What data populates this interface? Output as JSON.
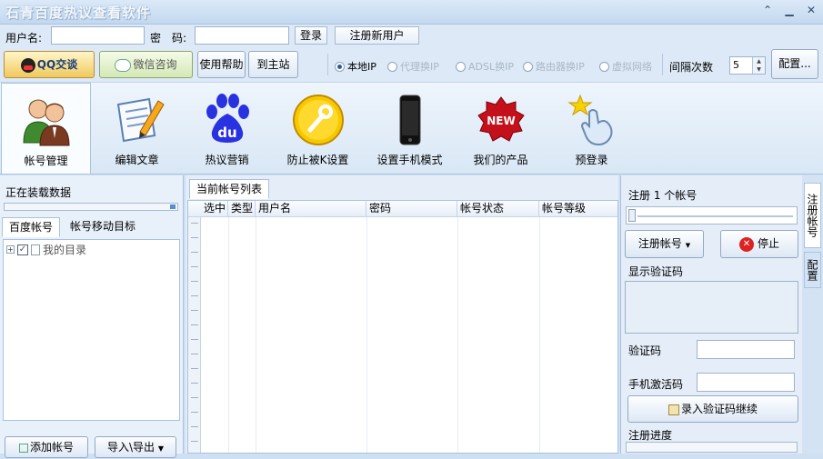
{
  "window": {
    "title": "石青百度热议查看软件"
  },
  "login": {
    "username_label": "用户名:",
    "username_value": "",
    "password_label": "密　码:",
    "password_value": "",
    "login_button": "登录",
    "register_button": "注册新用户"
  },
  "toolbar": {
    "qq_button": "QQ交谈",
    "wechat_button": "微信咨询",
    "help_button": "使用帮助",
    "site_button": "到主站",
    "ip_options": [
      {
        "label": "本地IP",
        "selected": true,
        "enabled": true
      },
      {
        "label": "代理换IP",
        "selected": false,
        "enabled": false
      },
      {
        "label": "ADSL换IP",
        "selected": false,
        "enabled": false
      },
      {
        "label": "路由器换IP",
        "selected": false,
        "enabled": false
      },
      {
        "label": "虚拟网络",
        "selected": false,
        "enabled": false
      }
    ],
    "interval_label": "间隔次数",
    "interval_value": "5",
    "config_button": "配置..."
  },
  "ribbon": {
    "tabs": [
      {
        "label": "帐号管理",
        "icon": "account-icon",
        "active": true
      },
      {
        "label": "编辑文章",
        "icon": "edit-article-icon",
        "active": false
      },
      {
        "label": "热议营销",
        "icon": "baidu-icon",
        "active": false
      },
      {
        "label": "防止被K设置",
        "icon": "wrench-icon",
        "active": false
      },
      {
        "label": "设置手机模式",
        "icon": "phone-icon",
        "active": false
      },
      {
        "label": "我们的产品",
        "icon": "new-badge-icon",
        "active": false
      },
      {
        "label": "预登录",
        "icon": "hand-pointer-icon",
        "active": false
      }
    ]
  },
  "left": {
    "status": "正在装载数据",
    "tabs": [
      "百度帐号",
      "帐号移动目标"
    ],
    "tree_root": "我的目录",
    "add_button": "添加帐号",
    "import_button": "导入\\导出"
  },
  "middle": {
    "tab": "当前帐号列表",
    "columns": [
      "选中",
      "类型",
      "用户名",
      "密码",
      "帐号状态",
      "帐号等级"
    ]
  },
  "right": {
    "register_count_label": "注册 1 个帐号",
    "register_button": "注册帐号",
    "stop_button": "停止",
    "captcha_display_label": "显示验证码",
    "captcha_label": "验证码",
    "sms_label": "手机激活码",
    "submit_captcha_button": "录入验证码继续",
    "progress_label": "注册进度"
  },
  "side_tabs": [
    "注册帐号",
    "配置"
  ],
  "colors": {
    "accent": "#2a5d99",
    "background": "#cfe0f3",
    "stop_red": "#d22"
  }
}
